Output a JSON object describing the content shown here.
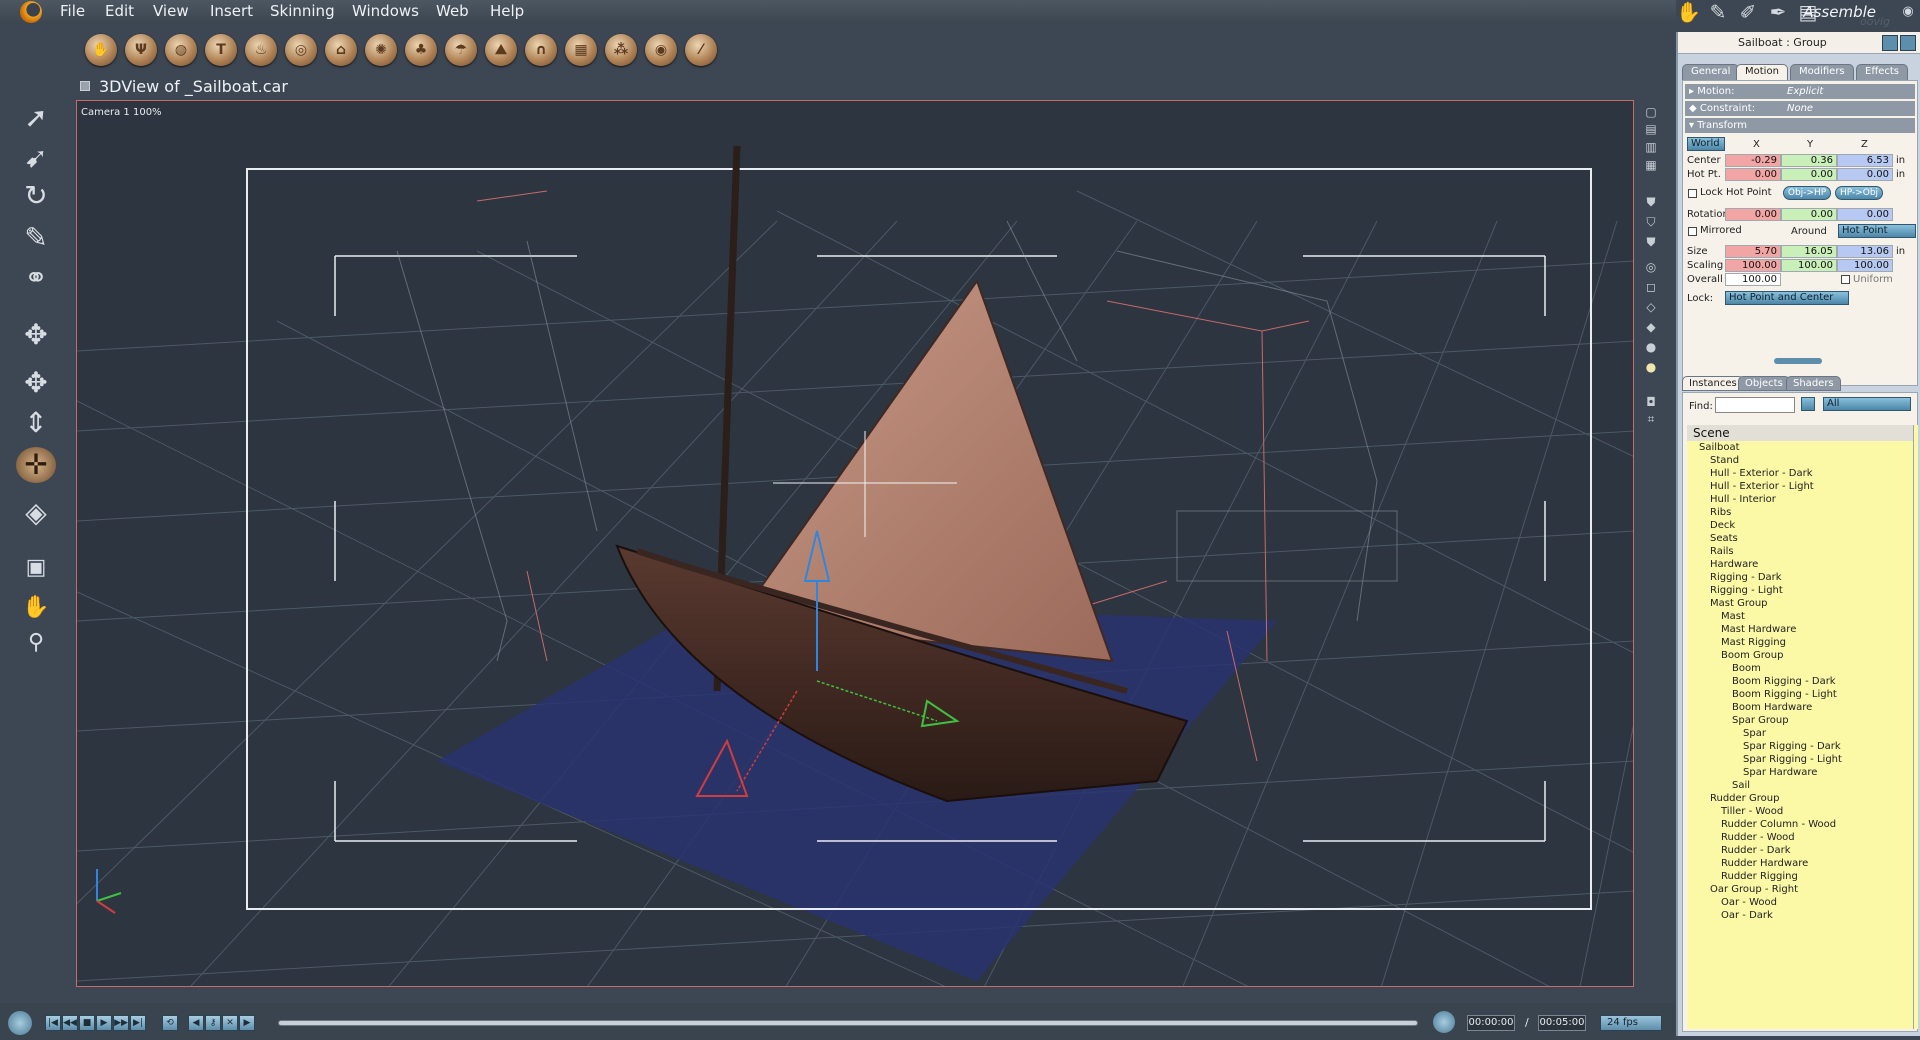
{
  "menu": {
    "items": [
      "File",
      "Edit",
      "View",
      "Insert",
      "Skinning",
      "Windows",
      "Web",
      "Help"
    ]
  },
  "room": {
    "label": "Assemble",
    "watermark": "oovig"
  },
  "toolbar": {
    "tools": [
      "hand-tool-icon",
      "figure-icon",
      "sphere-icon",
      "text-icon",
      "flame-icon",
      "torus-icon",
      "terrain-icon",
      "cloud-icon",
      "tree-icon",
      "umbrella-icon",
      "landscape-icon",
      "cave-icon",
      "grid-icon",
      "scatter-icon",
      "ring-icon",
      "wand-icon"
    ]
  },
  "document": {
    "title": "3DView of _Sailboat.car",
    "camera_label": "Camera 1 100%"
  },
  "timeline": {
    "current_time": "00:00:00",
    "separator": "/",
    "end_time": "00:05:00",
    "fps": "24 fps"
  },
  "panel": {
    "title": "Sailboat : Group",
    "tabs": [
      "General",
      "Motion",
      "Modifiers",
      "Effects"
    ],
    "motion": {
      "label": "Motion:",
      "value": "Explicit"
    },
    "constraint": {
      "label": "Constraint:",
      "value": "None"
    },
    "transform_label": "Transform",
    "space": "World",
    "axes": [
      "X",
      "Y",
      "Z"
    ],
    "center": {
      "label": "Center",
      "x": "-0.29",
      "y": "0.36",
      "z": "6.53",
      "unit": "in"
    },
    "hotpt": {
      "label": "Hot Pt.",
      "x": "0.00",
      "y": "0.00",
      "z": "0.00",
      "unit": "in"
    },
    "lock_hot_point": "Lock Hot Point",
    "obj_hp": "Obj->HP",
    "hp_obj": "HP->Obj",
    "rotation": {
      "label": "Rotation",
      "x": "0.00",
      "y": "0.00",
      "z": "0.00"
    },
    "mirrored": "Mirrored",
    "around": "Around",
    "around_value": "Hot Point",
    "size": {
      "label": "Size",
      "x": "5.70",
      "y": "16.05",
      "z": "13.06",
      "unit": "in"
    },
    "scaling": {
      "label": "Scaling",
      "x": "100.00",
      "y": "100.00",
      "z": "100.00"
    },
    "overall": {
      "label": "Overall",
      "value": "100.00",
      "uniform": "Uniform"
    },
    "lock": {
      "label": "Lock:",
      "value": "Hot Point and Center"
    }
  },
  "instances": {
    "tabs": [
      "Instances",
      "Objects",
      "Shaders"
    ],
    "find_label": "Find:",
    "filter": "All",
    "scene_label": "Scene",
    "tree": [
      {
        "label": "Sailboat",
        "depth": 0
      },
      {
        "label": "Stand",
        "depth": 1
      },
      {
        "label": "Hull - Exterior - Dark",
        "depth": 1
      },
      {
        "label": "Hull - Exterior - Light",
        "depth": 1
      },
      {
        "label": "Hull - Interior",
        "depth": 1
      },
      {
        "label": "Ribs",
        "depth": 1
      },
      {
        "label": "Deck",
        "depth": 1
      },
      {
        "label": "Seats",
        "depth": 1
      },
      {
        "label": "Rails",
        "depth": 1
      },
      {
        "label": "Hardware",
        "depth": 1
      },
      {
        "label": "Rigging - Dark",
        "depth": 1
      },
      {
        "label": "Rigging - Light",
        "depth": 1
      },
      {
        "label": "Mast Group",
        "depth": 1
      },
      {
        "label": "Mast",
        "depth": 2
      },
      {
        "label": "Mast Hardware",
        "depth": 2
      },
      {
        "label": "Mast Rigging",
        "depth": 2
      },
      {
        "label": "Boom Group",
        "depth": 2
      },
      {
        "label": "Boom",
        "depth": 3
      },
      {
        "label": "Boom Rigging - Dark",
        "depth": 3
      },
      {
        "label": "Boom Rigging - Light",
        "depth": 3
      },
      {
        "label": "Boom Hardware",
        "depth": 3
      },
      {
        "label": "Spar Group",
        "depth": 3
      },
      {
        "label": "Spar",
        "depth": 4
      },
      {
        "label": "Spar Rigging - Dark",
        "depth": 4
      },
      {
        "label": "Spar Rigging - Light",
        "depth": 4
      },
      {
        "label": "Spar Hardware",
        "depth": 4
      },
      {
        "label": "Sail",
        "depth": 3
      },
      {
        "label": "Rudder Group",
        "depth": 1
      },
      {
        "label": "Tiller - Wood",
        "depth": 2
      },
      {
        "label": "Rudder Column - Wood",
        "depth": 2
      },
      {
        "label": "Rudder - Wood",
        "depth": 2
      },
      {
        "label": "Rudder - Dark",
        "depth": 2
      },
      {
        "label": "Rudder Hardware",
        "depth": 2
      },
      {
        "label": "Rudder Rigging",
        "depth": 2
      },
      {
        "label": "Oar Group - Right",
        "depth": 1
      },
      {
        "label": "Oar - Wood",
        "depth": 2
      },
      {
        "label": "Oar - Dark",
        "depth": 2
      }
    ]
  },
  "colors": {
    "accent": "#f0a11c",
    "selection_box": "#c76a6a",
    "tree_bg": "#fbf8a6"
  }
}
